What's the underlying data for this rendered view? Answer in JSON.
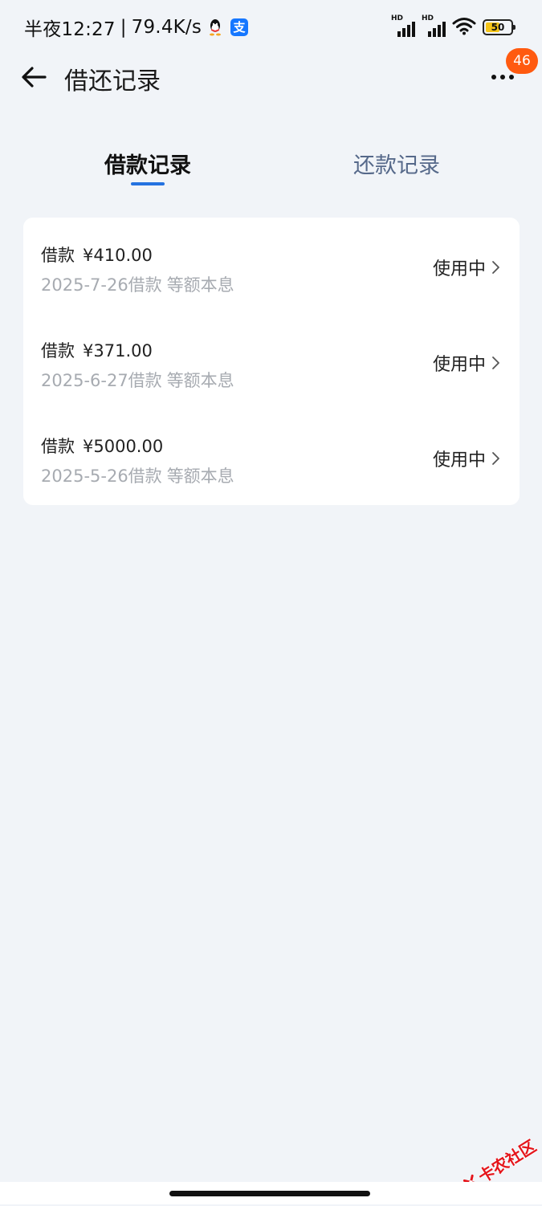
{
  "status_bar": {
    "time": "半夜12:27",
    "separator": "|",
    "network_speed": "79.4K/s",
    "alipay_glyph": "支",
    "hd_label": "HD",
    "battery": "50",
    "icons": [
      "qq-icon",
      "alipay-icon",
      "signal-icon",
      "wifi-icon",
      "battery-icon"
    ]
  },
  "header": {
    "title": "借还记录",
    "badge_count": "46",
    "icons": [
      "back-arrow-icon",
      "more-dots-icon"
    ]
  },
  "tabs": [
    {
      "label": "借款记录",
      "active": true
    },
    {
      "label": "还款记录",
      "active": false
    }
  ],
  "records": [
    {
      "kind": "借款",
      "amount": "¥410.00",
      "date": "2025-7-26借款",
      "method": "等额本息",
      "status": "使用中"
    },
    {
      "kind": "借款",
      "amount": "¥371.00",
      "date": "2025-6-27借款",
      "method": "等额本息",
      "status": "使用中"
    },
    {
      "kind": "借款",
      "amount": "¥5000.00",
      "date": "2025-5-26借款",
      "method": "等额本息",
      "status": "使用中"
    }
  ],
  "watermark": {
    "text": "卡农社区"
  },
  "colors": {
    "background": "#f1f4f8",
    "accent": "#2472e0",
    "badge": "#ff5a10",
    "muted_text": "#a7abb1",
    "inactive_tab": "#56698a"
  }
}
